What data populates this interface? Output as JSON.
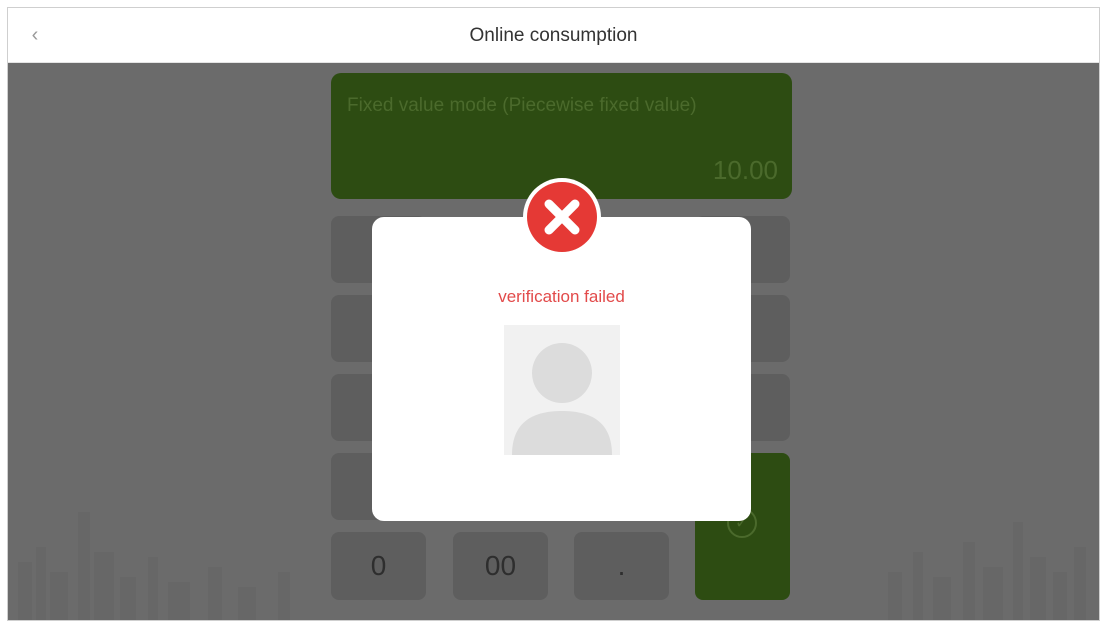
{
  "header": {
    "title": "Online consumption",
    "back_icon": "chevron-left-icon"
  },
  "amount_panel": {
    "mode_label": "Fixed value mode (Piecewise fixed value)",
    "value": "10.00"
  },
  "keypad": {
    "bottom_row": [
      "0",
      "00",
      "."
    ],
    "confirm_icon": "check-circle-icon"
  },
  "dialog": {
    "status_icon": "error-x-icon",
    "message": "verification failed",
    "avatar_icon": "user-placeholder-icon"
  },
  "colors": {
    "overlay": "#6b6b6b",
    "panel_green": "#2d4c12",
    "error_red": "#e53935",
    "message_red": "#e24a4a",
    "dialog_bg": "#ffffff"
  }
}
